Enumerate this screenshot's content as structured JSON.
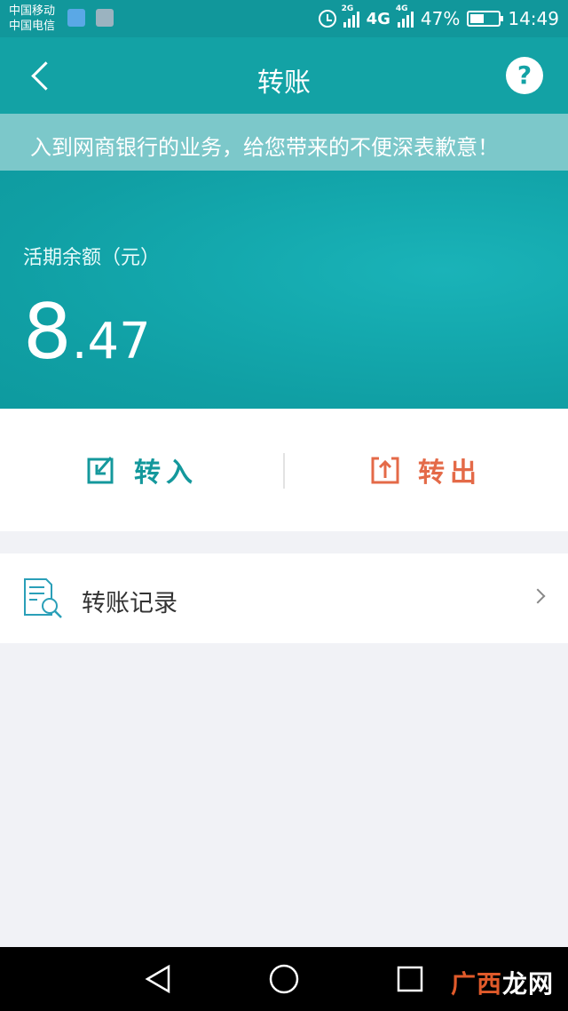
{
  "status_bar": {
    "carrier_1": "中国移动",
    "carrier_2": "中国电信",
    "sig_tag": "2G",
    "net_type": "4G",
    "sig_tag_2": "4G",
    "battery": "47%",
    "time": "14:49"
  },
  "header": {
    "title": "转账",
    "help_label": "?"
  },
  "notice": {
    "text": "入到网商银行的业务，给您带来的不便深表歉意！"
  },
  "balance": {
    "label": "活期余额（元）",
    "integer": "8",
    "decimal": ".47"
  },
  "actions": {
    "transfer_in": "转入",
    "transfer_out": "转出"
  },
  "records": {
    "label": "转账记录"
  },
  "watermark": {
    "text_a": "广西",
    "text_b": "龙网"
  },
  "colors": {
    "primary": "#13a2a5",
    "transfer_in": "#14989c",
    "transfer_out": "#e46a48",
    "background": "#f1f2f6"
  },
  "icons": {
    "back": "back-arrow-icon",
    "help": "question-mark-icon",
    "transfer_in": "transfer-in-icon",
    "transfer_out": "transfer-out-icon",
    "records": "document-search-icon",
    "chevron": "chevron-right-icon"
  }
}
